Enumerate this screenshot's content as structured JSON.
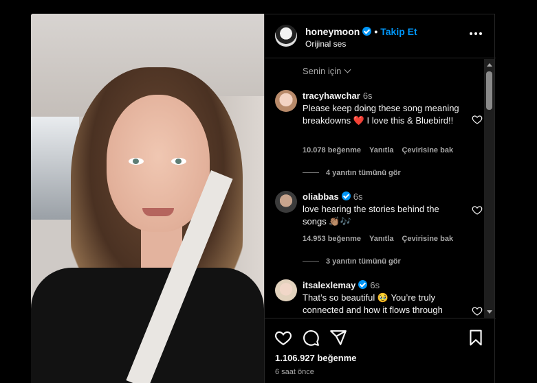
{
  "header": {
    "username": "honeymoon",
    "follow_label": "Takip Et",
    "separator": "•",
    "subtitle": "Orijinal ses"
  },
  "comments": {
    "sort_label": "Senin için",
    "items": [
      {
        "username": "tracyhawchar",
        "time": "6s",
        "verified": false,
        "text_before": "Please keep doing these song meaning breakdowns ",
        "emoji": "❤️",
        "text_after": " I love this & Bluebird!!",
        "likes": "10.078 beğenme",
        "reply_label": "Yanıtla",
        "translate_label": "Çevirisine bak",
        "replies_label": "4 yanıtın tümünü gör"
      },
      {
        "username": "oliabbas",
        "time": "6s",
        "verified": true,
        "text_before": "love hearing the stories behind the songs ",
        "emoji": "👏🏽🎶",
        "text_after": "",
        "likes": "14.953 beğenme",
        "reply_label": "Yanıtla",
        "translate_label": "Çevirisine bak",
        "replies_label": "3 yanıtın tümünü gör"
      },
      {
        "username": "itsalexlemay",
        "time": "6s",
        "verified": true,
        "text_before": "That’s so beautiful ",
        "emoji": "🥹",
        "text_after": " You’re truly connected and how it flows through",
        "likes": "",
        "reply_label": "",
        "translate_label": "",
        "replies_label": ""
      }
    ]
  },
  "footer": {
    "likes": "1.106.927 beğenme",
    "time_ago": "6 saat önce"
  },
  "icons": {
    "like": "heart-icon",
    "comment": "comment-icon",
    "share": "share-icon",
    "save": "bookmark-icon",
    "more": "more-icon",
    "verified": "verified-badge-icon"
  },
  "colors": {
    "background": "#000000",
    "accent": "#0095f6",
    "muted": "#a8a8a8",
    "heart": "#e0242f"
  }
}
